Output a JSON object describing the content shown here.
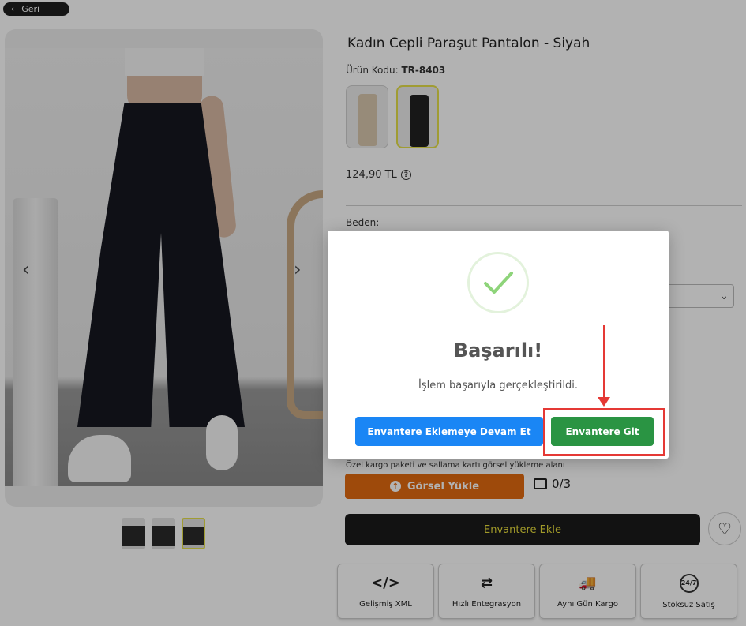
{
  "header": {
    "back_label": "Geri"
  },
  "product": {
    "title": "Kadın Cepli Paraşut Pantalon - Siyah",
    "code_label": "Ürün Kodu:",
    "code_value": "TR-8403",
    "price": "124,90 TL",
    "size_label": "Beden:",
    "variants": [
      "beige",
      "black"
    ],
    "selected_variant": "black"
  },
  "upload": {
    "label": "Özel kargo paketi ve sallama kartı görsel yükleme alanı",
    "button": "Görsel Yükle",
    "count": "0/3"
  },
  "actions": {
    "add_to_inventory": "Envantere Ekle"
  },
  "features": [
    {
      "icon": "code-icon",
      "symbol": "</>",
      "label": "Gelişmiş XML"
    },
    {
      "icon": "sync-arrows-icon",
      "symbol": "⇄",
      "label": "Hızlı Entegrasyon"
    },
    {
      "icon": "truck-icon",
      "symbol": "🚚",
      "label": "Aynı Gün Kargo"
    },
    {
      "icon": "24-7-icon",
      "symbol": "24/7",
      "label": "Stoksuz Satış"
    }
  ],
  "modal": {
    "title": "Başarılı!",
    "message": "İşlem başarıyla gerçekleştirildi.",
    "continue_button": "Envantere Eklemeye Devam Et",
    "goto_button": "Envantere Git"
  },
  "colors": {
    "primary_blue": "#1a86f5",
    "success_green": "#2a9443",
    "upload_orange": "#e36a10",
    "add_button_text": "#e7dd3c",
    "annotation_red": "#e53935"
  }
}
